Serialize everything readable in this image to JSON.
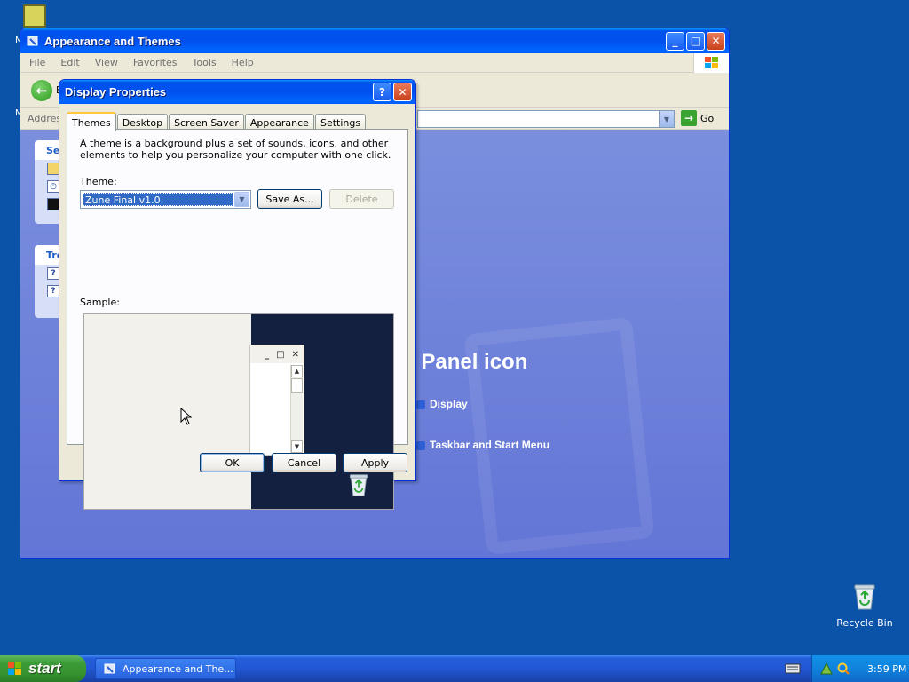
{
  "desktop": {
    "recycle_bin_label": "Recycle Bin",
    "partial_labels": [
      "M",
      "M"
    ]
  },
  "explorer": {
    "title": "Appearance and Themes",
    "menu": [
      "File",
      "Edit",
      "View",
      "Favorites",
      "Tools",
      "Help"
    ],
    "back_label": "B",
    "address_label": "Address",
    "go_label": "Go",
    "sidebar_headings": [
      "Se",
      "Tro"
    ],
    "content_heading": "l Panel icon",
    "links": [
      "Display",
      "Taskbar and Start Menu"
    ]
  },
  "dialog": {
    "title": "Display Properties",
    "help_glyph": "?",
    "tabs": [
      "Themes",
      "Desktop",
      "Screen Saver",
      "Appearance",
      "Settings"
    ],
    "active_tab": "Themes",
    "description": "A theme is a background plus a set of sounds, icons, and other elements to help you personalize your computer with one click.",
    "theme_label": "Theme:",
    "theme_value": "Zune Final v1.0",
    "save_as_label": "Save As...",
    "delete_label": "Delete",
    "sample_label": "Sample:",
    "ok_label": "OK",
    "cancel_label": "Cancel",
    "apply_label": "Apply"
  },
  "taskbar": {
    "start_label": "start",
    "task_item_label": "Appearance and The...",
    "clock": "3:59 PM"
  },
  "icons": [
    "control-panel-icon",
    "back-arrow-icon",
    "go-arrow-icon",
    "windows-flag-icon",
    "recycle-bin-icon",
    "keyboard-icon",
    "network-icon",
    "search-tray-icon",
    "mouse-cursor-icon"
  ],
  "colors": {
    "desktop_bg": "#0a53a8",
    "titlebar_blue": "#0050ee",
    "content_bg": "#6375d6",
    "selection": "#316ac5",
    "sample_desktop": "#14203f"
  }
}
